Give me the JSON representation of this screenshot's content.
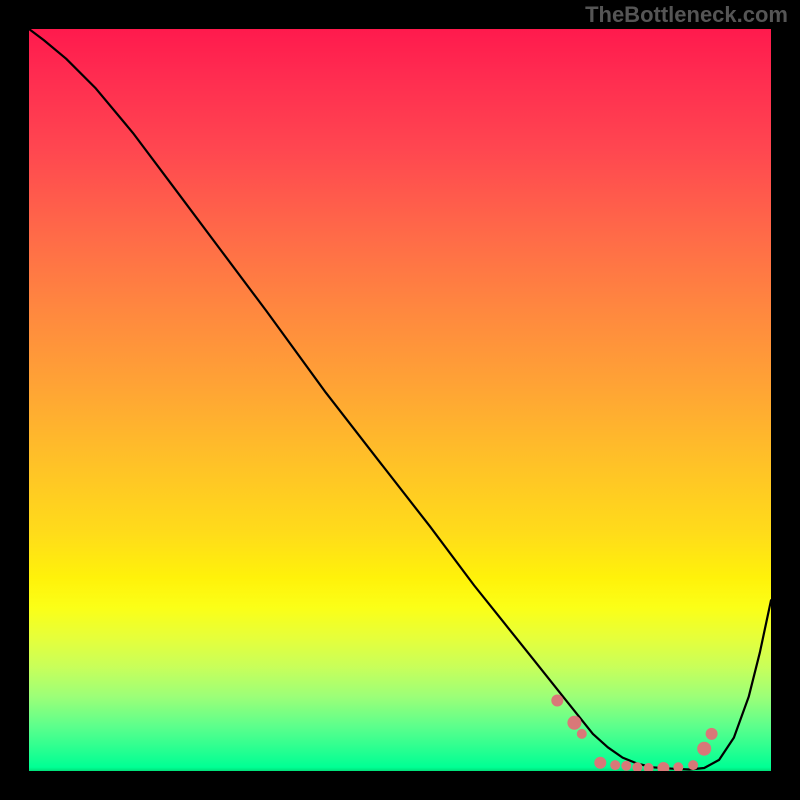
{
  "watermark": "TheBottleneck.com",
  "chart_data": {
    "type": "line",
    "title": "",
    "xlabel": "",
    "ylabel": "",
    "xlim": [
      0,
      1
    ],
    "ylim": [
      0,
      1
    ],
    "series": [
      {
        "name": "curve",
        "x": [
          0.0,
          0.02,
          0.05,
          0.09,
          0.14,
          0.2,
          0.26,
          0.32,
          0.4,
          0.47,
          0.54,
          0.6,
          0.64,
          0.68,
          0.72,
          0.74,
          0.76,
          0.78,
          0.8,
          0.82,
          0.84,
          0.87,
          0.89,
          0.91,
          0.93,
          0.95,
          0.97,
          0.985,
          1.0
        ],
        "y": [
          1.0,
          0.985,
          0.96,
          0.92,
          0.86,
          0.78,
          0.7,
          0.62,
          0.51,
          0.42,
          0.33,
          0.25,
          0.2,
          0.15,
          0.1,
          0.075,
          0.05,
          0.032,
          0.018,
          0.01,
          0.005,
          0.003,
          0.002,
          0.004,
          0.015,
          0.045,
          0.1,
          0.16,
          0.23
        ]
      }
    ],
    "markers": [
      {
        "x": 0.712,
        "y": 0.095,
        "r": 6
      },
      {
        "x": 0.735,
        "y": 0.065,
        "r": 7
      },
      {
        "x": 0.745,
        "y": 0.05,
        "r": 5
      },
      {
        "x": 0.77,
        "y": 0.011,
        "r": 6
      },
      {
        "x": 0.79,
        "y": 0.008,
        "r": 5
      },
      {
        "x": 0.805,
        "y": 0.007,
        "r": 5
      },
      {
        "x": 0.82,
        "y": 0.005,
        "r": 5
      },
      {
        "x": 0.835,
        "y": 0.004,
        "r": 5
      },
      {
        "x": 0.855,
        "y": 0.004,
        "r": 6
      },
      {
        "x": 0.875,
        "y": 0.005,
        "r": 5
      },
      {
        "x": 0.895,
        "y": 0.008,
        "r": 5
      },
      {
        "x": 0.91,
        "y": 0.03,
        "r": 7
      },
      {
        "x": 0.92,
        "y": 0.05,
        "r": 6
      }
    ],
    "colors": {
      "curve": "#000000",
      "markers": "#d97878",
      "gradient_top": "#ff1a4d",
      "gradient_mid": "#ffff00",
      "gradient_bottom": "#00ff94"
    }
  }
}
